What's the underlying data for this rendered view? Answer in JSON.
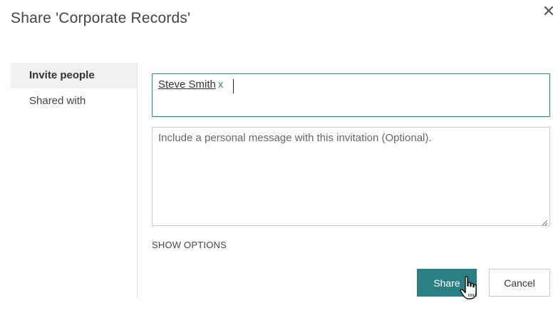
{
  "dialog": {
    "title": "Share 'Corporate Records'",
    "close_icon": "close-icon"
  },
  "nav": {
    "items": [
      {
        "label": "Invite people",
        "active": true
      },
      {
        "label": "Shared with",
        "active": false
      }
    ]
  },
  "invite": {
    "people": [
      {
        "name": "Steve Smith",
        "remove_label": "x"
      }
    ],
    "message_placeholder": "Include a personal message with this invitation (Optional).",
    "message_value": "",
    "show_options_label": "SHOW OPTIONS"
  },
  "actions": {
    "share_label": "Share",
    "cancel_label": "Cancel"
  },
  "colors": {
    "accent": "#2b7f83",
    "focus_border": "#2f8a8d",
    "nav_active_bg": "#f0f0f0"
  }
}
